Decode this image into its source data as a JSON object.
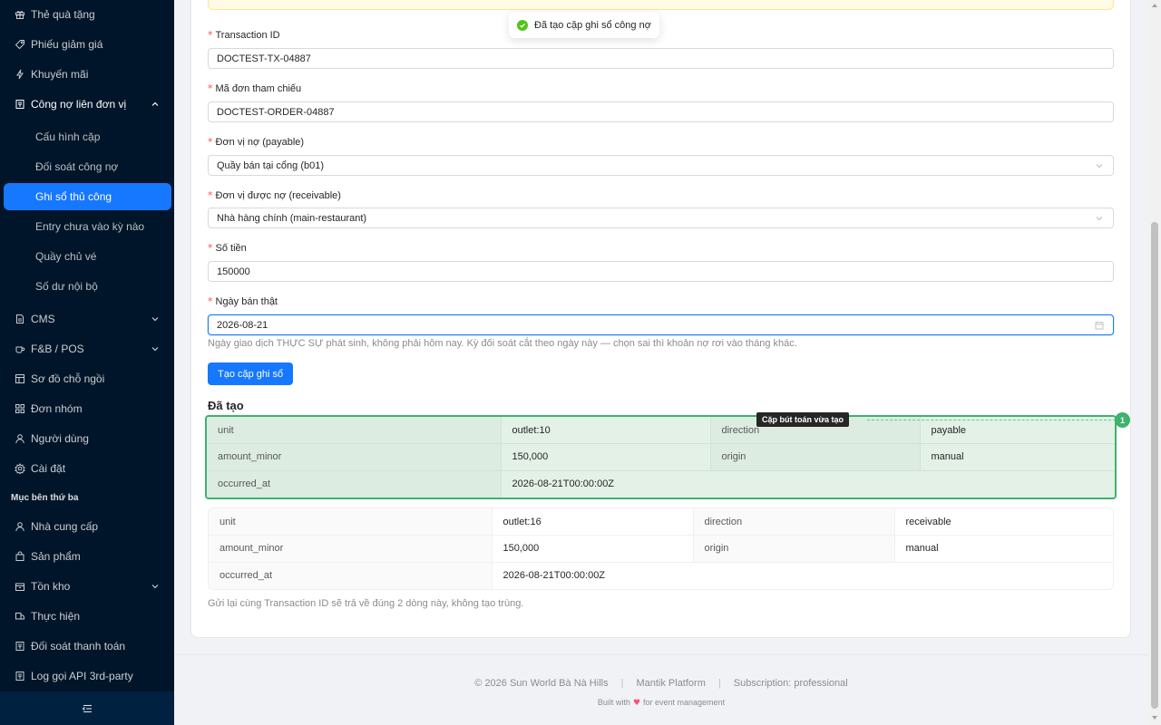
{
  "sidebar": {
    "items_top": [
      {
        "label": "Thẻ quà tặng",
        "icon": "gift-icon"
      },
      {
        "label": "Phiếu giảm giá",
        "icon": "tag-icon"
      },
      {
        "label": "Khuyến mãi",
        "icon": "flash-icon"
      }
    ],
    "open_group": {
      "label": "Công nợ liên đơn vị",
      "icon": "ledger-icon"
    },
    "sub_items": [
      {
        "label": "Cấu hình cặp"
      },
      {
        "label": "Đối soát công nợ"
      },
      {
        "label": "Ghi sổ thủ công",
        "active": true
      },
      {
        "label": "Entry chưa vào kỳ nào"
      },
      {
        "label": "Quầy chủ vé"
      },
      {
        "label": "Số dư nội bộ"
      }
    ],
    "items_mid": [
      {
        "label": "CMS",
        "icon": "file-icon",
        "chevron": true
      },
      {
        "label": "F&B / POS",
        "icon": "coffee-icon",
        "chevron": true
      },
      {
        "label": "Sơ đồ chỗ ngồi",
        "icon": "layout-icon"
      },
      {
        "label": "Đơn nhóm",
        "icon": "grid-icon"
      },
      {
        "label": "Người dùng",
        "icon": "user-icon"
      },
      {
        "label": "Cài đặt",
        "icon": "gear-icon"
      }
    ],
    "third_party_title": "Mục bên thứ ba",
    "items_bottom": [
      {
        "label": "Nhà cung cấp",
        "icon": "user-icon"
      },
      {
        "label": "Sản phẩm",
        "icon": "shopping-bag-icon"
      },
      {
        "label": "Tồn kho",
        "icon": "box-icon",
        "chevron": true
      },
      {
        "label": "Thực hiện",
        "icon": "truck-icon"
      },
      {
        "label": "Đối soát thanh toán",
        "icon": "reconcile-icon"
      },
      {
        "label": "Log gọi API 3rd-party",
        "icon": "log-icon"
      }
    ]
  },
  "toast": {
    "message": "Đã tạo cặp ghi sổ công nợ"
  },
  "form": {
    "transaction_id": {
      "label": "Transaction ID",
      "value": "DOCTEST-TX-04887"
    },
    "order_ref": {
      "label": "Mã đơn tham chiếu",
      "value": "DOCTEST-ORDER-04887"
    },
    "payable_unit": {
      "label": "Đơn vị nợ (payable)",
      "value": "Quầy bán tại cổng (b01)"
    },
    "receivable_unit": {
      "label": "Đơn vị được nợ (receivable)",
      "value": "Nhà hàng chính (main-restaurant)"
    },
    "amount": {
      "label": "Số tiền",
      "value": "150000"
    },
    "sale_date": {
      "label": "Ngày bán thật",
      "value": "2026-08-21",
      "help": "Ngày giao dịch THỰC SỰ phát sinh, không phải hôm nay. Kỳ đối soát cắt theo ngày này — chọn sai thì khoản nợ rơi vào tháng khác."
    },
    "submit_label": "Tạo cặp ghi sổ"
  },
  "created": {
    "title": "Đã tạo",
    "tooltip": "Cặp bút toán vừa tạo",
    "badge": "1",
    "entries": [
      {
        "unit_key": "unit",
        "unit": "outlet:10",
        "direction_key": "direction",
        "direction": "payable",
        "amount_key": "amount_minor",
        "amount": "150,000",
        "origin_key": "origin",
        "origin": "manual",
        "occurred_key": "occurred_at",
        "occurred": "2026-08-21T00:00:00Z"
      },
      {
        "unit_key": "unit",
        "unit": "outlet:16",
        "direction_key": "direction",
        "direction": "receivable",
        "amount_key": "amount_minor",
        "amount": "150,000",
        "origin_key": "origin",
        "origin": "manual",
        "occurred_key": "occurred_at",
        "occurred": "2026-08-21T00:00:00Z"
      }
    ],
    "note": "Gửi lại cùng Transaction ID sẽ trả về đúng 2 dòng này, không tạo trùng."
  },
  "footer": {
    "copyright": "© 2026 Sun World Bà Nà Hills",
    "platform": "Mantik Platform",
    "subscription": "Subscription: professional",
    "built_prefix": "Built with",
    "built_suffix": "for event management"
  }
}
